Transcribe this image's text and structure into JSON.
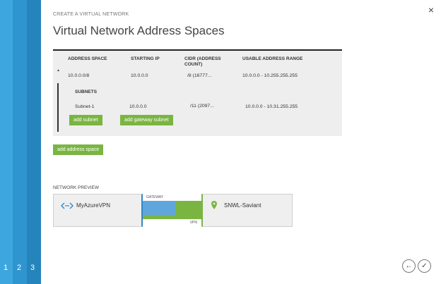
{
  "dialog": {
    "kicker": "CREATE A VIRTUAL NETWORK",
    "title": "Virtual Network Address Spaces",
    "close_label": "×"
  },
  "steps": [
    "1",
    "2",
    "3"
  ],
  "address_table": {
    "headers": {
      "address_space": "ADDRESS SPACE",
      "starting_ip": "STARTING IP",
      "cidr": "CIDR (ADDRESS COUNT)",
      "usable_range": "USABLE ADDRESS RANGE"
    },
    "expand_icon": "▲",
    "row": {
      "address_space": "10.0.0.0/8",
      "starting_ip": "10.0.0.0",
      "cidr": "/8 (16777...",
      "usable_range": "10.0.0.0 - 10.255.255.255"
    },
    "subnets_header": "SUBNETS",
    "subnet": {
      "name": "Subnet-1",
      "starting_ip": "10.0.0.0",
      "cidr": "/11 (2097...",
      "usable_range": "10.0.0.0 - 10.31.255.255"
    },
    "add_subnet_label": "add subnet",
    "add_gateway_subnet_label": "add gateway subnet"
  },
  "add_address_space_label": "add address space",
  "network_preview": {
    "label": "NETWORK PREVIEW",
    "vnet_name": "MyAzureVPN",
    "gateway_label": "GATEWAY",
    "vpn_label": "VPN",
    "site_name": "SNWL-Saviant",
    "colors": {
      "vnet": "#2e89c8",
      "gateway": "#5fa6dc",
      "vpn": "#7ab542"
    }
  },
  "nav": {
    "back_icon": "←",
    "confirm_icon": "✓"
  }
}
